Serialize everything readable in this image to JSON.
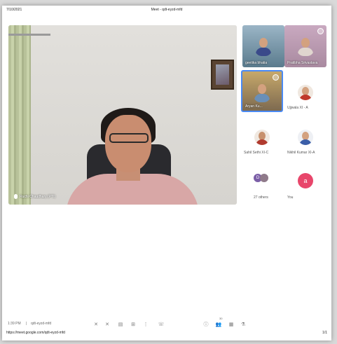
{
  "print": {
    "date": "7/10/2021",
    "title": "Meet - qdt-eyzd-mfd",
    "url": "https://meet.google.com/qdt-eyzd-mfd",
    "page": "1/1"
  },
  "main_video": {
    "name": "Ruchi Chaudhary (PTI)"
  },
  "participants": {
    "tile1": {
      "label": "geetika bhatia"
    },
    "tile2": {
      "label": "Pratibha Srivastava"
    },
    "tile3": {
      "label": "Aryan Ku..."
    },
    "tile4": {
      "label": "Ujjwala XI - A"
    },
    "tile5": {
      "label": "Sahil Sethi XI-C"
    },
    "tile6": {
      "label": "Nikhil Kumar XI-A"
    },
    "tile7": {
      "label": "27 others",
      "badge_letter": "D"
    },
    "tile8": {
      "label": "You",
      "avatar_letter": "a"
    }
  },
  "bottom_bar": {
    "time": "1:39 PM",
    "meeting_code": "qdt-eyzd-mfd",
    "people_count": "30"
  },
  "colors": {
    "you_avatar": "#e8466b",
    "others_badge": "#7b5ea7"
  }
}
